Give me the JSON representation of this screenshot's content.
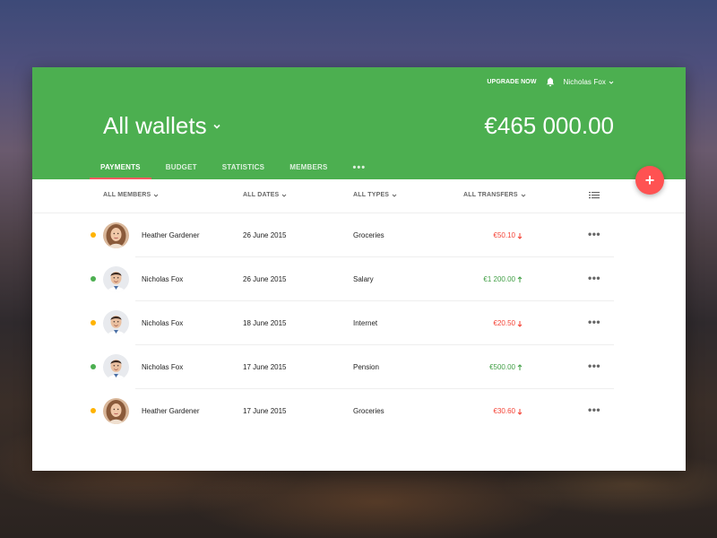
{
  "header": {
    "upgrade_label": "UPGRADE NOW",
    "user_name": "Nicholas Fox",
    "wallet_title": "All wallets",
    "balance": "€465 000.00"
  },
  "tabs": [
    {
      "label": "PAYMENTS",
      "active": true
    },
    {
      "label": "BUDGET",
      "active": false
    },
    {
      "label": "STATISTICS",
      "active": false
    },
    {
      "label": "MEMBERS",
      "active": false
    },
    {
      "label": "•••",
      "active": false
    }
  ],
  "fab": {
    "label": "+"
  },
  "filters": {
    "members": "ALL MEMBERS",
    "dates": "ALL DATES",
    "types": "ALL TYPES",
    "transfers": "ALL TRANSFERS"
  },
  "transactions": [
    {
      "status": "pending",
      "status_color": "#ffb300",
      "avatar": "female-avatar",
      "name": "Heather Gardener",
      "date": "26 June 2015",
      "type": "Groceries",
      "amount": "€50.10",
      "direction": "down",
      "amount_color": "#f44336"
    },
    {
      "status": "completed",
      "status_color": "#4caf50",
      "avatar": "male-avatar",
      "name": "Nicholas Fox",
      "date": "26 June 2015",
      "type": "Salary",
      "amount": "€1 200.00",
      "direction": "up",
      "amount_color": "#43a047"
    },
    {
      "status": "pending",
      "status_color": "#ffb300",
      "avatar": "male-avatar",
      "name": "Nicholas Fox",
      "date": "18 June 2015",
      "type": "Internet",
      "amount": "€20.50",
      "direction": "down",
      "amount_color": "#f44336"
    },
    {
      "status": "completed",
      "status_color": "#4caf50",
      "avatar": "male-avatar",
      "name": "Nicholas Fox",
      "date": "17 June 2015",
      "type": "Pension",
      "amount": "€500.00",
      "direction": "up",
      "amount_color": "#43a047"
    },
    {
      "status": "pending",
      "status_color": "#ffb300",
      "avatar": "female-avatar",
      "name": "Heather Gardener",
      "date": "17 June 2015",
      "type": "Groceries",
      "amount": "€30.60",
      "direction": "down",
      "amount_color": "#f44336"
    }
  ],
  "row_menu_label": "•••",
  "colors": {
    "header_green": "#4caf50",
    "accent_red": "#ff5252",
    "tab_indicator": "#ff5a5f"
  }
}
